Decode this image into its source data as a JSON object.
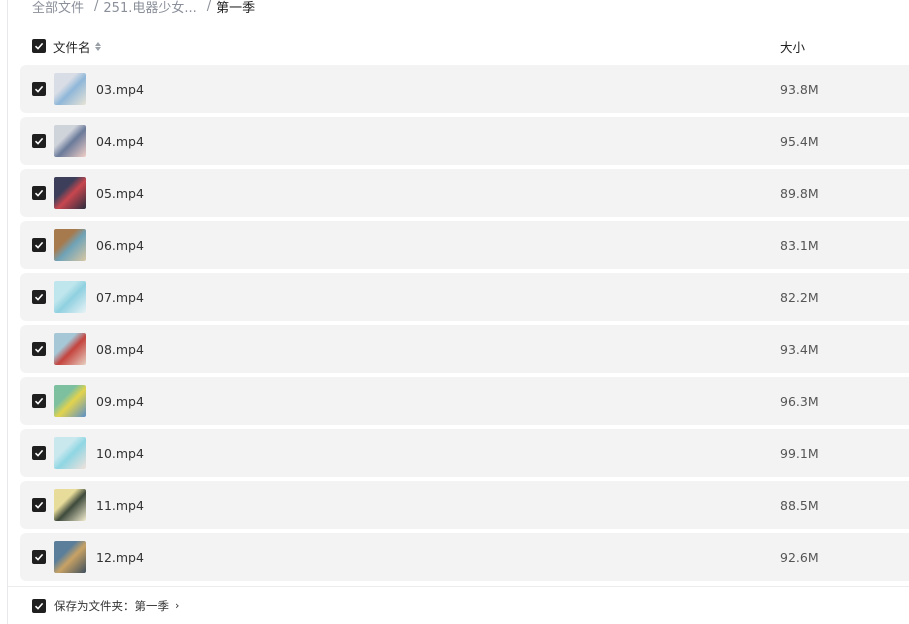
{
  "breadcrumb": {
    "root": "全部文件",
    "parent": "251.电器少女...",
    "current": "第一季"
  },
  "header": {
    "name_label": "文件名",
    "size_label": "大小"
  },
  "files": [
    {
      "name": "03.mp4",
      "size": "93.8M",
      "thumb": [
        "#d9dde6",
        "#8fb7d9",
        "#e9e4d6"
      ]
    },
    {
      "name": "04.mp4",
      "size": "95.4M",
      "thumb": [
        "#cfd3da",
        "#6a7a9a",
        "#f2d0c8"
      ]
    },
    {
      "name": "05.mp4",
      "size": "89.8M",
      "thumb": [
        "#3d3f5a",
        "#c8464e",
        "#2a2c3e"
      ]
    },
    {
      "name": "06.mp4",
      "size": "83.1M",
      "thumb": [
        "#a77a4e",
        "#6fa3b8",
        "#d9c7a2"
      ]
    },
    {
      "name": "07.mp4",
      "size": "82.2M",
      "thumb": [
        "#bfe6ec",
        "#8fd0e0",
        "#eaf4f6"
      ]
    },
    {
      "name": "08.mp4",
      "size": "93.4M",
      "thumb": [
        "#a5c7d6",
        "#c4443e",
        "#e8d0c2"
      ]
    },
    {
      "name": "09.mp4",
      "size": "96.3M",
      "thumb": [
        "#7cc0a0",
        "#e3d34d",
        "#5b8fc9"
      ]
    },
    {
      "name": "10.mp4",
      "size": "99.1M",
      "thumb": [
        "#c9e8ee",
        "#8fd6e3",
        "#f1e2dc"
      ]
    },
    {
      "name": "11.mp4",
      "size": "88.5M",
      "thumb": [
        "#e8dc9a",
        "#3e4a3c",
        "#f3eed0"
      ]
    },
    {
      "name": "12.mp4",
      "size": "92.6M",
      "thumb": [
        "#5b7e9a",
        "#c8a264",
        "#3e4f5e"
      ]
    }
  ],
  "footer": {
    "save_label": "保存为文件夹：第一季",
    "chevron": "›"
  }
}
